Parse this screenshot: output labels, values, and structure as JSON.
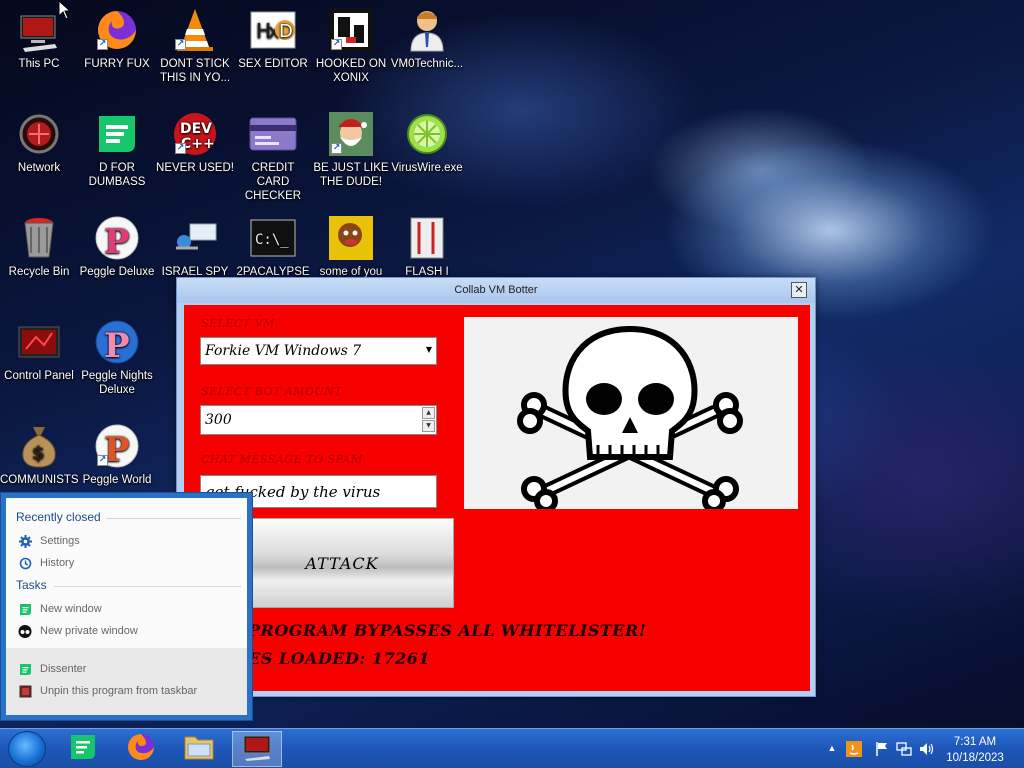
{
  "desktop": {
    "icons": [
      {
        "label": "This PC"
      },
      {
        "label": "FURRY FUX"
      },
      {
        "label": "DONT STICK THIS IN YO..."
      },
      {
        "label": "SEX EDITOR"
      },
      {
        "label": "HOOKED ON XONIX"
      },
      {
        "label": "VM0Technic..."
      },
      {
        "label": "Network"
      },
      {
        "label": "D FOR DUMBASS"
      },
      {
        "label": "NEVER USED!"
      },
      {
        "label": "CREDIT CARD CHECKER"
      },
      {
        "label": "BE JUST LIKE THE DUDE!"
      },
      {
        "label": "VirusWire.exe"
      },
      {
        "label": "Recycle Bin"
      },
      {
        "label": "Peggle Deluxe"
      },
      {
        "label": "ISRAEL SPY"
      },
      {
        "label": "2PACALYPSE"
      },
      {
        "label": "some of you"
      },
      {
        "label": "FLASH I"
      },
      {
        "label": "Control Panel"
      },
      {
        "label": "Peggle Nights Deluxe"
      },
      {
        "label": "COMMUNISTS"
      },
      {
        "label": "Peggle World"
      }
    ],
    "devcpp_text": "DEV\nC++"
  },
  "window": {
    "title": "Collab VM Botter",
    "close_glyph": "✕",
    "select_vm_label": "SELECT VM",
    "select_vm_value": "Forkie VM Windows 7",
    "bot_amount_label": "SELECT BOT AMOUNT",
    "bot_amount_value": "300",
    "chat_label": "CHAT MESSAGE TO SPAM",
    "chat_value": "get fucked by the virus",
    "attack_label": "ATTACK",
    "bypass_text": "PROGRAM BYPASSES ALL WHITELISTER!",
    "proxies_text": "ES LOADED: 17261"
  },
  "jumplist": {
    "recent_title": "Recently closed",
    "recent_items": [
      "Settings",
      "History"
    ],
    "tasks_title": "Tasks",
    "task_items": [
      "New window",
      "New private window"
    ],
    "pinned_app": "Dissenter",
    "unpin_label": "Unpin this program from taskbar"
  },
  "taskbar": {
    "time": "7:31 AM",
    "date": "10/18/2023"
  },
  "colors": {
    "window_client": "#f70000",
    "taskbar": "#1e57b9",
    "jumplist_accent": "#1d4a8a"
  }
}
